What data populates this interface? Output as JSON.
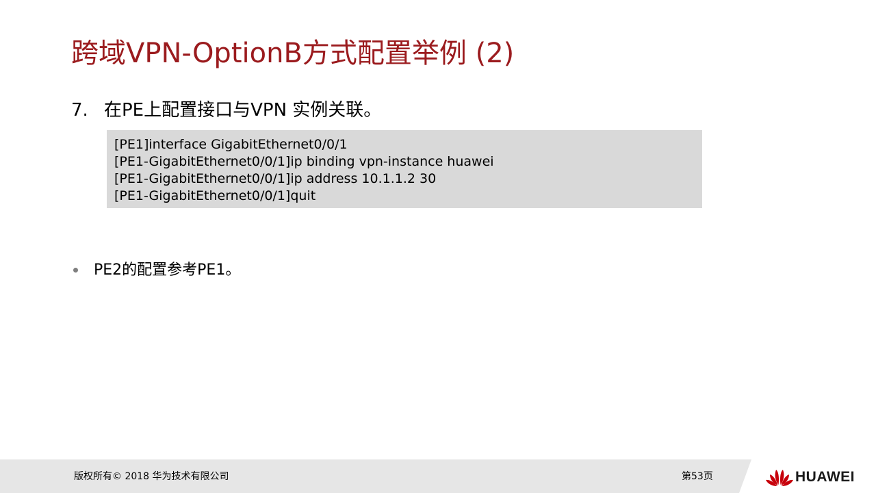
{
  "slide": {
    "title": "跨域VPN-OptionB方式配置举例 (2)",
    "step": {
      "number": "7.",
      "text": "在PE上配置接口与VPN 实例关联。"
    },
    "code_lines": [
      "[PE1]interface GigabitEthernet0/0/1",
      "[PE1-GigabitEthernet0/0/1]ip  binding vpn-instance huawei",
      "[PE1-GigabitEthernet0/0/1]ip  address 10.1.1.2  30",
      "[PE1-GigabitEthernet0/0/1]quit"
    ],
    "bullet_text": "PE2的配置参考PE1。"
  },
  "footer": {
    "copyright": "版权所有© 2018 华为技术有限公司",
    "page_number": "第53页",
    "logo_text": "HUAWEI",
    "logo_icon": "huawei-petal-logo"
  },
  "colors": {
    "title": "#9b1b1e",
    "code_background": "#d9d9d9",
    "footer_background": "#e6e6e6",
    "logo_red": "#c7000b",
    "bullet_dot": "#7f7f7f"
  }
}
